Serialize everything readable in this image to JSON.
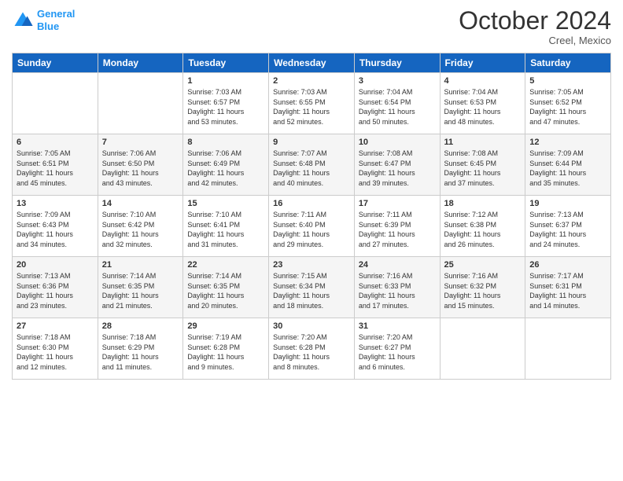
{
  "logo": {
    "line1": "General",
    "line2": "Blue"
  },
  "title": "October 2024",
  "location": "Creel, Mexico",
  "days_header": [
    "Sunday",
    "Monday",
    "Tuesday",
    "Wednesday",
    "Thursday",
    "Friday",
    "Saturday"
  ],
  "weeks": [
    [
      {
        "day": "",
        "info": ""
      },
      {
        "day": "",
        "info": ""
      },
      {
        "day": "1",
        "info": "Sunrise: 7:03 AM\nSunset: 6:57 PM\nDaylight: 11 hours\nand 53 minutes."
      },
      {
        "day": "2",
        "info": "Sunrise: 7:03 AM\nSunset: 6:55 PM\nDaylight: 11 hours\nand 52 minutes."
      },
      {
        "day": "3",
        "info": "Sunrise: 7:04 AM\nSunset: 6:54 PM\nDaylight: 11 hours\nand 50 minutes."
      },
      {
        "day": "4",
        "info": "Sunrise: 7:04 AM\nSunset: 6:53 PM\nDaylight: 11 hours\nand 48 minutes."
      },
      {
        "day": "5",
        "info": "Sunrise: 7:05 AM\nSunset: 6:52 PM\nDaylight: 11 hours\nand 47 minutes."
      }
    ],
    [
      {
        "day": "6",
        "info": "Sunrise: 7:05 AM\nSunset: 6:51 PM\nDaylight: 11 hours\nand 45 minutes."
      },
      {
        "day": "7",
        "info": "Sunrise: 7:06 AM\nSunset: 6:50 PM\nDaylight: 11 hours\nand 43 minutes."
      },
      {
        "day": "8",
        "info": "Sunrise: 7:06 AM\nSunset: 6:49 PM\nDaylight: 11 hours\nand 42 minutes."
      },
      {
        "day": "9",
        "info": "Sunrise: 7:07 AM\nSunset: 6:48 PM\nDaylight: 11 hours\nand 40 minutes."
      },
      {
        "day": "10",
        "info": "Sunrise: 7:08 AM\nSunset: 6:47 PM\nDaylight: 11 hours\nand 39 minutes."
      },
      {
        "day": "11",
        "info": "Sunrise: 7:08 AM\nSunset: 6:45 PM\nDaylight: 11 hours\nand 37 minutes."
      },
      {
        "day": "12",
        "info": "Sunrise: 7:09 AM\nSunset: 6:44 PM\nDaylight: 11 hours\nand 35 minutes."
      }
    ],
    [
      {
        "day": "13",
        "info": "Sunrise: 7:09 AM\nSunset: 6:43 PM\nDaylight: 11 hours\nand 34 minutes."
      },
      {
        "day": "14",
        "info": "Sunrise: 7:10 AM\nSunset: 6:42 PM\nDaylight: 11 hours\nand 32 minutes."
      },
      {
        "day": "15",
        "info": "Sunrise: 7:10 AM\nSunset: 6:41 PM\nDaylight: 11 hours\nand 31 minutes."
      },
      {
        "day": "16",
        "info": "Sunrise: 7:11 AM\nSunset: 6:40 PM\nDaylight: 11 hours\nand 29 minutes."
      },
      {
        "day": "17",
        "info": "Sunrise: 7:11 AM\nSunset: 6:39 PM\nDaylight: 11 hours\nand 27 minutes."
      },
      {
        "day": "18",
        "info": "Sunrise: 7:12 AM\nSunset: 6:38 PM\nDaylight: 11 hours\nand 26 minutes."
      },
      {
        "day": "19",
        "info": "Sunrise: 7:13 AM\nSunset: 6:37 PM\nDaylight: 11 hours\nand 24 minutes."
      }
    ],
    [
      {
        "day": "20",
        "info": "Sunrise: 7:13 AM\nSunset: 6:36 PM\nDaylight: 11 hours\nand 23 minutes."
      },
      {
        "day": "21",
        "info": "Sunrise: 7:14 AM\nSunset: 6:35 PM\nDaylight: 11 hours\nand 21 minutes."
      },
      {
        "day": "22",
        "info": "Sunrise: 7:14 AM\nSunset: 6:35 PM\nDaylight: 11 hours\nand 20 minutes."
      },
      {
        "day": "23",
        "info": "Sunrise: 7:15 AM\nSunset: 6:34 PM\nDaylight: 11 hours\nand 18 minutes."
      },
      {
        "day": "24",
        "info": "Sunrise: 7:16 AM\nSunset: 6:33 PM\nDaylight: 11 hours\nand 17 minutes."
      },
      {
        "day": "25",
        "info": "Sunrise: 7:16 AM\nSunset: 6:32 PM\nDaylight: 11 hours\nand 15 minutes."
      },
      {
        "day": "26",
        "info": "Sunrise: 7:17 AM\nSunset: 6:31 PM\nDaylight: 11 hours\nand 14 minutes."
      }
    ],
    [
      {
        "day": "27",
        "info": "Sunrise: 7:18 AM\nSunset: 6:30 PM\nDaylight: 11 hours\nand 12 minutes."
      },
      {
        "day": "28",
        "info": "Sunrise: 7:18 AM\nSunset: 6:29 PM\nDaylight: 11 hours\nand 11 minutes."
      },
      {
        "day": "29",
        "info": "Sunrise: 7:19 AM\nSunset: 6:28 PM\nDaylight: 11 hours\nand 9 minutes."
      },
      {
        "day": "30",
        "info": "Sunrise: 7:20 AM\nSunset: 6:28 PM\nDaylight: 11 hours\nand 8 minutes."
      },
      {
        "day": "31",
        "info": "Sunrise: 7:20 AM\nSunset: 6:27 PM\nDaylight: 11 hours\nand 6 minutes."
      },
      {
        "day": "",
        "info": ""
      },
      {
        "day": "",
        "info": ""
      }
    ]
  ]
}
